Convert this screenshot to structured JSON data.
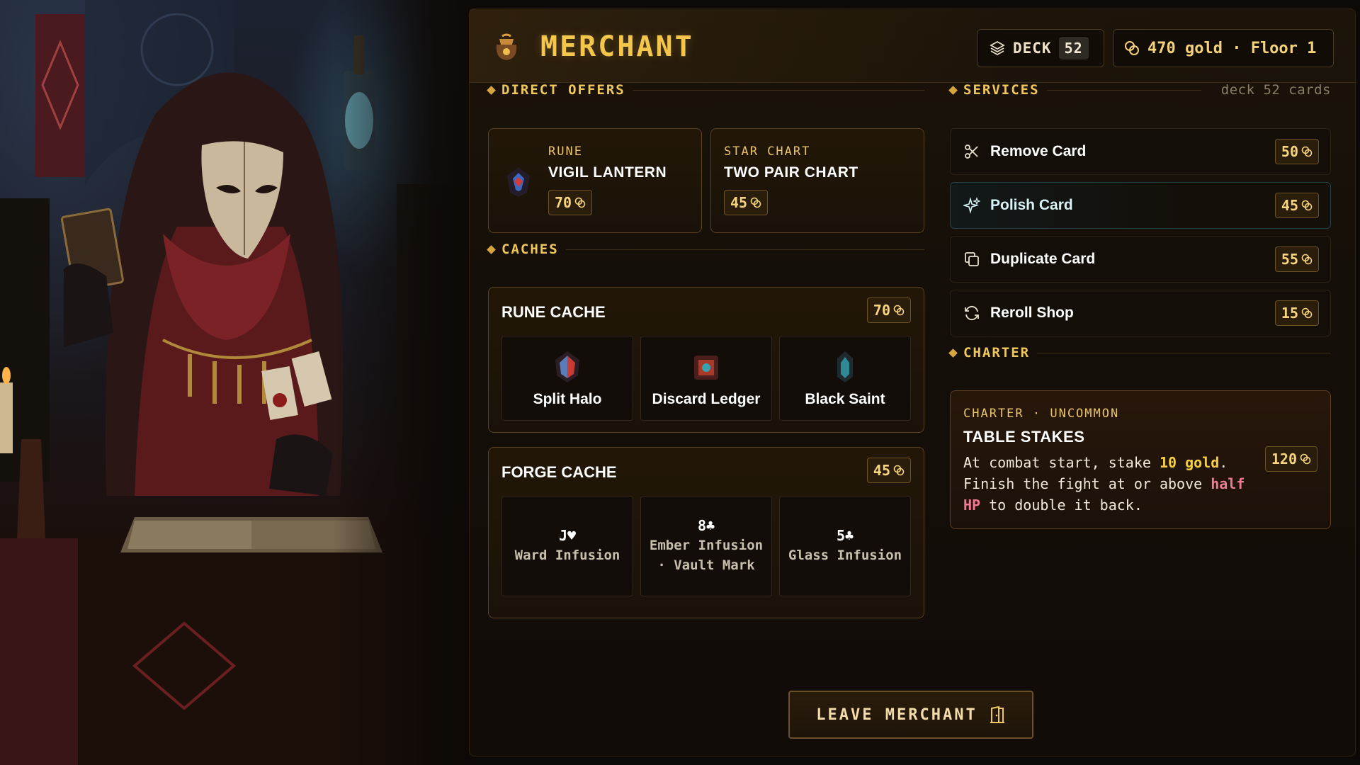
{
  "header": {
    "title": "MERCHANT",
    "deck_label": "DECK",
    "deck_count": "52",
    "gold_text": "470 gold · Floor 1"
  },
  "direct_offers": {
    "heading": "DIRECT OFFERS",
    "items": [
      {
        "kind": "RUNE",
        "name": "VIGIL LANTERN",
        "price": "70"
      },
      {
        "kind": "STAR CHART",
        "name": "TWO PAIR CHART",
        "price": "45"
      }
    ]
  },
  "caches": {
    "heading": "CACHES",
    "rune": {
      "title": "RUNE CACHE",
      "price": "70",
      "items": [
        {
          "name": "Split Halo"
        },
        {
          "name": "Discard Ledger"
        },
        {
          "name": "Black Saint"
        }
      ]
    },
    "forge": {
      "title": "FORGE CACHE",
      "price": "45",
      "items": [
        {
          "card": "J♥",
          "label": "Ward Infusion"
        },
        {
          "card": "8♣",
          "label": "Ember Infusion · Vault Mark"
        },
        {
          "card": "5♣",
          "label": "Glass Infusion"
        }
      ]
    }
  },
  "services": {
    "heading": "SERVICES",
    "note": "deck 52 cards",
    "items": [
      {
        "label": "Remove Card",
        "price": "50",
        "icon": "scissors-icon"
      },
      {
        "label": "Polish Card",
        "price": "45",
        "icon": "sparkle-icon"
      },
      {
        "label": "Duplicate Card",
        "price": "55",
        "icon": "copy-icon"
      },
      {
        "label": "Reroll Shop",
        "price": "15",
        "icon": "refresh-icon"
      }
    ]
  },
  "charter": {
    "heading": "CHARTER",
    "kicker": "CHARTER · UNCOMMON",
    "name": "TABLE STAKES",
    "desc_1": "At combat start, stake ",
    "desc_gold": "10 gold",
    "desc_2": ". Finish the fight at or above ",
    "desc_red": "half HP",
    "desc_3": " to double it back.",
    "price": "120"
  },
  "leave_button": "LEAVE MERCHANT",
  "colors": {
    "accent_gold": "#f4c64c",
    "price_gold": "#f6d57e",
    "highlight_red": "#f07a92",
    "panel_bg": "#150f09"
  }
}
